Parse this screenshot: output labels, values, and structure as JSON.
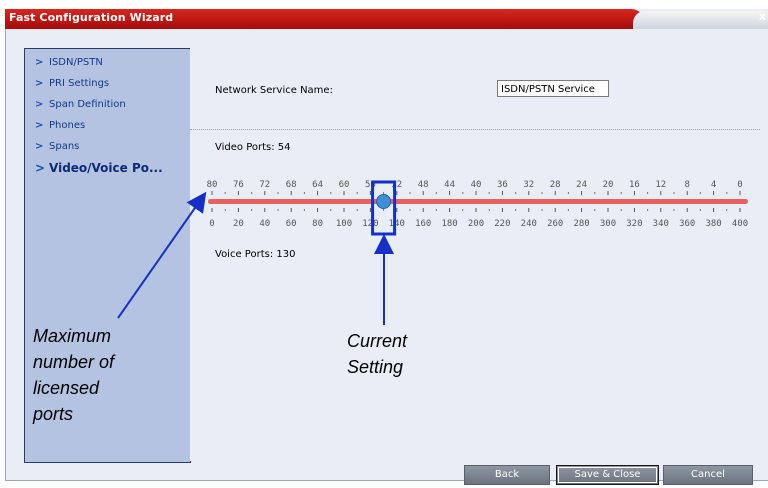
{
  "window": {
    "title": "Fast Configuration Wizard",
    "close_glyph": "x"
  },
  "sidebar": {
    "items": [
      {
        "label": "ISDN/PSTN",
        "active": false
      },
      {
        "label": "PRI Settings",
        "active": false
      },
      {
        "label": "Span Definition",
        "active": false
      },
      {
        "label": "Phones",
        "active": false
      },
      {
        "label": "Spans",
        "active": false
      },
      {
        "label": "Video/Voice Po...",
        "active": true
      }
    ],
    "chevron": ">"
  },
  "form": {
    "network_service_label": "Network Service Name:",
    "network_service_value": "ISDN/PSTN Service",
    "video_ports_label": "Video Ports: 54",
    "voice_ports_label": "Voice Ports: 130"
  },
  "slider": {
    "video_scale": [
      "80",
      "76",
      "72",
      "68",
      "64",
      "60",
      "56",
      "52",
      "48",
      "44",
      "40",
      "36",
      "32",
      "28",
      "24",
      "20",
      "16",
      "12",
      "8",
      "4",
      "0"
    ],
    "voice_scale": [
      "0",
      "20",
      "40",
      "60",
      "80",
      "100",
      "120",
      "140",
      "160",
      "180",
      "200",
      "220",
      "240",
      "260",
      "280",
      "300",
      "320",
      "340",
      "360",
      "380",
      "400"
    ],
    "current_voice": 130,
    "max_voice": 400,
    "track_color": "#e86060",
    "thumb_color": "#3f8fd8",
    "highlight_color": "#1530c8"
  },
  "annotations": {
    "max_ports": [
      "Maximum",
      "number of",
      "licensed",
      "ports"
    ],
    "current": [
      "Current",
      "Setting"
    ]
  },
  "buttons": {
    "back": "Back",
    "save_close": "Save & Close",
    "cancel": "Cancel"
  }
}
